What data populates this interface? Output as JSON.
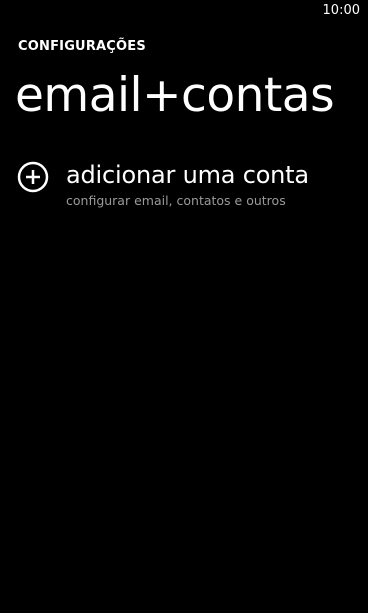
{
  "status_bar": {
    "time": "10:00"
  },
  "header": {
    "app_title": "CONFIGURAÇÕES",
    "page_title": "email+contas"
  },
  "add_account": {
    "icon": "plus-circle-icon",
    "label": "adicionar uma conta",
    "sublabel": "configurar email, contatos e outros"
  },
  "colors": {
    "background": "#000000",
    "foreground": "#ffffff",
    "subtle_text": "#9a9a9a"
  }
}
